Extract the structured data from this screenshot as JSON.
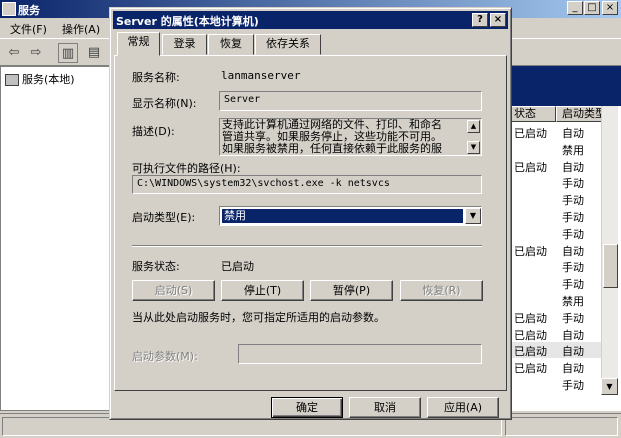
{
  "background_window": {
    "title": "服务",
    "menu": [
      "文件(F)",
      "操作(A)"
    ],
    "tree_item": "服务(本地)",
    "columns": [
      "状态",
      "启动类型"
    ],
    "rows": [
      {
        "status": "已启动",
        "startup": "自动"
      },
      {
        "status": "",
        "startup": "禁用"
      },
      {
        "status": "已启动",
        "startup": "自动"
      },
      {
        "status": "",
        "startup": "手动"
      },
      {
        "status": "",
        "startup": "手动"
      },
      {
        "status": "",
        "startup": "手动"
      },
      {
        "status": "",
        "startup": "手动"
      },
      {
        "status": "已启动",
        "startup": "自动"
      },
      {
        "status": "",
        "startup": "手动"
      },
      {
        "status": "",
        "startup": "手动"
      },
      {
        "status": "",
        "startup": "禁用"
      },
      {
        "status": "已启动",
        "startup": "手动"
      },
      {
        "status": "已启动",
        "startup": "自动"
      },
      {
        "status": "已启动",
        "startup": "自动"
      },
      {
        "status": "已启动",
        "startup": "自动"
      },
      {
        "status": "",
        "startup": "手动"
      }
    ]
  },
  "dialog": {
    "title": "Server 的属性(本地计算机)",
    "help_btn": "?",
    "close_btn": "×",
    "tabs": [
      "常规",
      "登录",
      "恢复",
      "依存关系"
    ],
    "service_name_label": "服务名称:",
    "service_name": "lanmanserver",
    "display_name_label": "显示名称(N):",
    "display_name": "Server",
    "description_label": "描述(D):",
    "description_lines": [
      "支持此计算机通过网络的文件、打印、和命名",
      "管道共享。如果服务停止，这些功能不可用。",
      "如果服务被禁用，任何直接依赖于此服务的服"
    ],
    "exe_path_label": "可执行文件的路径(H):",
    "exe_path": "C:\\WINDOWS\\system32\\svchost.exe -k netsvcs",
    "startup_type_label": "启动类型(E):",
    "startup_type_value": "禁用",
    "service_status_label": "服务状态:",
    "service_status": "已启动",
    "buttons": {
      "start": "启动(S)",
      "stop": "停止(T)",
      "pause": "暂停(P)",
      "resume": "恢复(R)"
    },
    "hint_text": "当从此处启动服务时，您可指定所适用的启动参数。",
    "start_params_label": "启动参数(M):",
    "start_params_value": "",
    "ok": "确定",
    "cancel": "取消",
    "apply": "应用(A)"
  }
}
